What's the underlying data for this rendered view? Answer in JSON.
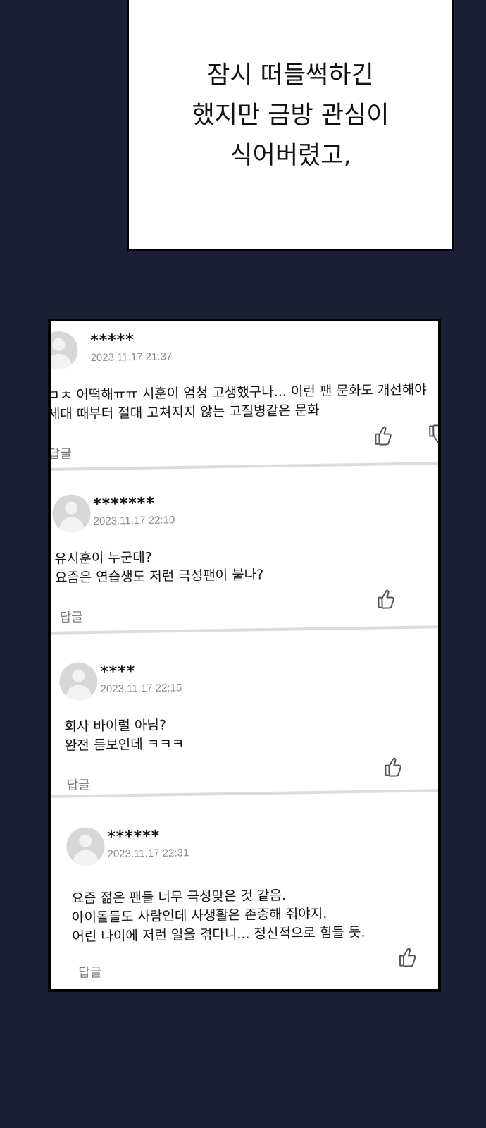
{
  "narration": {
    "lines": [
      "잠시 떠들썩하긴",
      "했지만 금방 관심이",
      "식어버렸고,"
    ]
  },
  "comments": [
    {
      "user": "*****",
      "date": "2023.11.17  21:37",
      "lines": [
        "ㅁㅊ 어떡해ㅠㅠ 시훈이 엄청 고생했구나... 이런 팬 문화도 개선해야",
        "세대 때부터 절대 고쳐지지 않는 고질병같은 문화"
      ],
      "reply": "답글",
      "like_icon": "thumbs-up-icon",
      "dislike_icon": "thumbs-down-icon"
    },
    {
      "user": "*******",
      "date": "2023.11.17  22:10",
      "lines": [
        "유시훈이 누군데?",
        "요즘은 연습생도 저런 극성팬이 붙나?"
      ],
      "reply": "답글",
      "like_icon": "thumbs-up-icon"
    },
    {
      "user": "****",
      "date": "2023.11.17  22:15",
      "lines": [
        "회사 바이럴 아님?",
        "완전 듣보인데 ㅋㅋㅋ"
      ],
      "reply": "답글",
      "like_icon": "thumbs-up-icon"
    },
    {
      "user": "******",
      "date": "2023.11.17  22:31",
      "lines": [
        "요즘 젊은 팬들 너무 극성맞은 것 같음.",
        "아이돌들도 사람인데 사생활은 존중해 줘야지.",
        "어린 나이에 저런 일을 겪다니... 정신적으로 힘들 듯."
      ],
      "reply": "답글",
      "like_icon": "thumbs-up-icon"
    }
  ]
}
